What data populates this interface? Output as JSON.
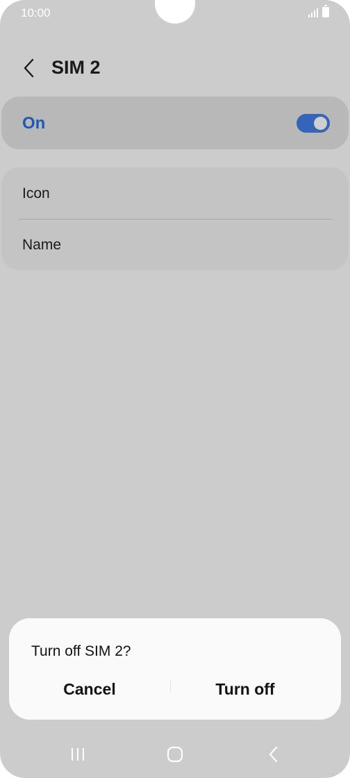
{
  "status_bar": {
    "time": "10:00"
  },
  "header": {
    "title": "SIM 2"
  },
  "sim_toggle": {
    "label": "On",
    "state": true,
    "accent_color": "#3565b8"
  },
  "settings_list": {
    "items": [
      {
        "label": "Icon"
      },
      {
        "label": "Name"
      }
    ]
  },
  "dialog": {
    "title": "Turn off SIM 2?",
    "cancel_label": "Cancel",
    "confirm_label": "Turn off"
  },
  "nav_bar": {
    "icons": [
      "recent-apps-icon",
      "home-icon",
      "back-icon"
    ]
  }
}
